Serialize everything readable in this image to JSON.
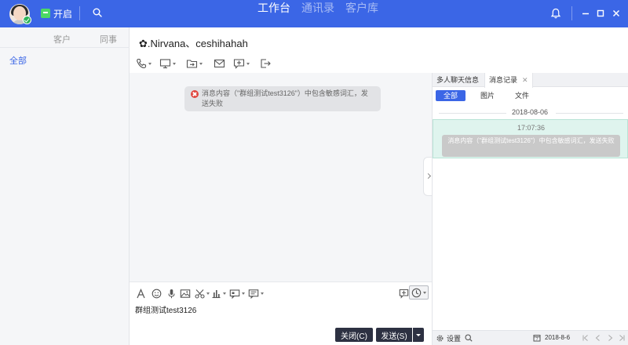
{
  "topbar": {
    "open_label": "开启",
    "tabs": [
      {
        "label": "工作台",
        "active": true
      },
      {
        "label": "通讯录",
        "active": false
      },
      {
        "label": "客户库",
        "active": false
      }
    ],
    "accent": "#3b66e6"
  },
  "sidebar": {
    "tabs": [
      "客户",
      "同事"
    ],
    "all_label": "全部"
  },
  "chat": {
    "title": "✿.Nirvana、ceshihahah",
    "system_message": "消息内容（\"群组测试test3126\"）中包含敏感词汇，发送失败",
    "input_value": "群组测试test3126",
    "close_button": "关闭(C)",
    "send_button": "发送(S)"
  },
  "right_panel": {
    "tabs": [
      {
        "label": "多人聊天信息",
        "active": false
      },
      {
        "label": "消息记录",
        "active": true
      }
    ],
    "filters": [
      {
        "label": "全部",
        "active": true
      },
      {
        "label": "图片",
        "active": false
      },
      {
        "label": "文件",
        "active": false
      }
    ],
    "date_divider": "2018-08-06",
    "record": {
      "time": "17:07:36",
      "message": "消息内容（\"群组测试test3126\"）中包含敏感词汇，发送失败"
    },
    "footer": {
      "settings_label": "设置",
      "date": "2018-8-6"
    }
  }
}
